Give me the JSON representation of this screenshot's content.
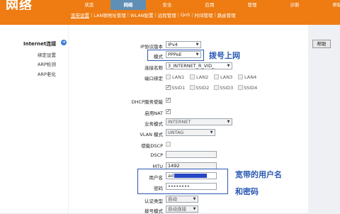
{
  "brand": "网络",
  "main_nav": [
    "状态",
    "网络",
    "安全",
    "应用",
    "管理",
    "诊断",
    "帮助"
  ],
  "sub_nav": [
    "宽带设置",
    "LAN侧地址管理",
    "WLAN配置",
    "远程管理",
    "QoS",
    "时间管理",
    "路由管理"
  ],
  "sidebar": {
    "title": "Internet连接",
    "items": [
      "绑定设置",
      "ARP检测",
      "ARP老化"
    ]
  },
  "help_button": "帮助",
  "form": {
    "ip_version": {
      "label": "IP协议版本",
      "value": "IPv4"
    },
    "mode": {
      "label": "模式",
      "value": "PPPoE"
    },
    "conn_name": {
      "label": "连接名称",
      "value": "3_INTERNET_R_VID_"
    },
    "port_bind": {
      "label": "端口绑定",
      "ports": [
        {
          "name": "LAN1",
          "checked": false
        },
        {
          "name": "LAN2",
          "checked": false
        },
        {
          "name": "LAN3",
          "checked": false
        },
        {
          "name": "LAN4",
          "checked": false
        },
        {
          "name": "SSID1",
          "checked": true
        },
        {
          "name": "SSID2",
          "checked": false
        },
        {
          "name": "SSID3",
          "checked": false
        },
        {
          "name": "SSID4",
          "checked": false
        }
      ]
    },
    "dhcp": {
      "label": "DHCP服务使能",
      "checked": true
    },
    "nat": {
      "label": "启用NAT",
      "checked": true
    },
    "service_mode": {
      "label": "业务模式",
      "value": "INTERNET"
    },
    "vlan_mode": {
      "label": "VLAN 模式",
      "value": "UNTAG"
    },
    "dscp_enable": {
      "label": "使能DSCP",
      "checked": false
    },
    "dscp": {
      "label": "DSCP",
      "value": ""
    },
    "mtu": {
      "label": "MTU",
      "value": "1492"
    },
    "username": {
      "label": "用户名",
      "value": "ad"
    },
    "password": {
      "label": "密码",
      "value": "••••••••"
    },
    "auth_type": {
      "label": "认证类型",
      "value": "自动"
    },
    "dial_mode": {
      "label": "拨号模式",
      "value": "自动连接"
    }
  },
  "annotations": {
    "dial": "拨号上网",
    "credentials_line1": "宽带的用户名",
    "credentials_line2": "和密码"
  },
  "colors": {
    "header": "#ee7c12",
    "active_tab": "#5f8fb6",
    "annotation": "#2a58b3"
  }
}
